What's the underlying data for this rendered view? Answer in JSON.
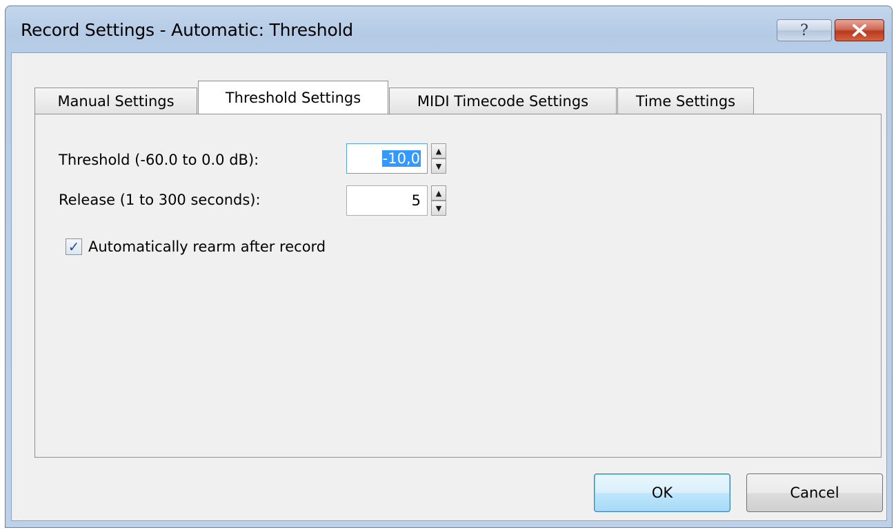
{
  "window": {
    "title": "Record Settings - Automatic: Threshold",
    "help_glyph": "?",
    "close_glyph": "✕"
  },
  "tabs": [
    {
      "label": "Manual Settings",
      "active": false
    },
    {
      "label": "Threshold Settings",
      "active": true
    },
    {
      "label": "MIDI Timecode Settings",
      "active": false
    },
    {
      "label": "Time Settings",
      "active": false
    }
  ],
  "threshold": {
    "label": "Threshold (-60.0 to 0.0 dB):",
    "value": "-10,0"
  },
  "release": {
    "label": "Release (1 to 300 seconds):",
    "value": "5"
  },
  "rearm": {
    "label": "Automatically rearm after record",
    "checked": true,
    "check_glyph": "✓"
  },
  "spin_glyphs": {
    "up": "▲",
    "down": "▼"
  },
  "buttons": {
    "ok": "OK",
    "cancel": "Cancel"
  }
}
